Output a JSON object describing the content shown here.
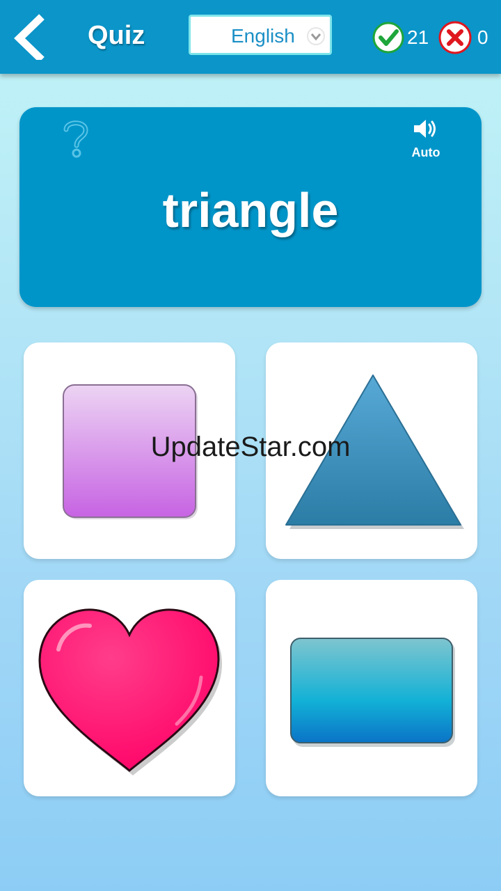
{
  "header": {
    "title": "Quiz",
    "language": "English",
    "correct_count": "21",
    "wrong_count": "0"
  },
  "question": {
    "word": "triangle",
    "audio_label": "Auto"
  },
  "answers": [
    {
      "shape": "rounded-square",
      "color": "#d07be8"
    },
    {
      "shape": "triangle",
      "color": "#3a8fbf"
    },
    {
      "shape": "heart",
      "color": "#ff0066"
    },
    {
      "shape": "rectangle",
      "color": "#12b1d6"
    }
  ],
  "watermark": "UpdateStar.com",
  "colors": {
    "topbar": "#0b95c9",
    "card": "#0095c9",
    "correct": "#1ea63b",
    "wrong": "#e0161e"
  }
}
